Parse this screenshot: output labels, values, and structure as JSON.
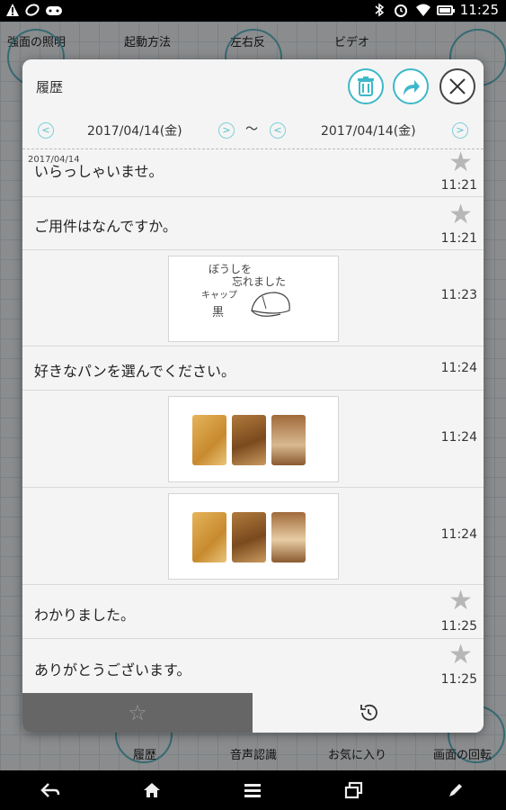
{
  "status_bar": {
    "time": "11:25",
    "icons": [
      "warning-icon",
      "leaf-icon",
      "gamepad-icon",
      "bluetooth-icon",
      "alarm-icon",
      "wifi-icon",
      "battery-icon"
    ],
    "battery_level_percent": 90
  },
  "background_app": {
    "top_labels": [
      "強面の照明",
      "起動方法",
      "左右反",
      "ビデオ"
    ],
    "bottom_labels": [
      "履歴",
      "音声認識",
      "お気に入り",
      "画面の回転"
    ],
    "accent_color": "#3aa7b9"
  },
  "dialog": {
    "title": "履歴",
    "header_buttons": {
      "delete": "trash-icon",
      "share": "share-icon",
      "close": "close-icon"
    },
    "date_range": {
      "start": "2017/04/14(金)",
      "separator": "〜",
      "end": "2017/04/14(金)",
      "prev_label": "<",
      "next_label": ">"
    },
    "items": [
      {
        "type": "text",
        "date_label": "2017/04/14",
        "text": "いらっしゃいませ。",
        "time": "11:21",
        "starred": false
      },
      {
        "type": "text",
        "text": "ご用件はなんですか。",
        "time": "11:21",
        "starred": false
      },
      {
        "type": "drawing",
        "lines": [
          "ぼうしを",
          "忘れました",
          "キャップ",
          "黒"
        ],
        "time": "11:23"
      },
      {
        "type": "text",
        "text": "好きなパンを選んでください。",
        "time": "11:24"
      },
      {
        "type": "image",
        "content": "bread-images",
        "time": "11:24"
      },
      {
        "type": "image",
        "content": "bread-images",
        "time": "11:24"
      },
      {
        "type": "text",
        "text": "わかりました。",
        "time": "11:25",
        "starred": false
      },
      {
        "type": "text",
        "text": "ありがとうございます。",
        "time": "11:25",
        "starred": false
      }
    ],
    "tabs": [
      {
        "name": "favorites",
        "icon": "star-icon",
        "label": "☆",
        "active": true
      },
      {
        "name": "history",
        "icon": "history-icon",
        "active": false
      }
    ],
    "colors": {
      "accent": "#3db8c9",
      "active_tab": "#666666",
      "star": "#b7b7b7"
    }
  },
  "nav_bar": {
    "buttons": [
      "back-icon",
      "home-icon",
      "menu-icon",
      "recents-icon",
      "pen-icon"
    ]
  }
}
